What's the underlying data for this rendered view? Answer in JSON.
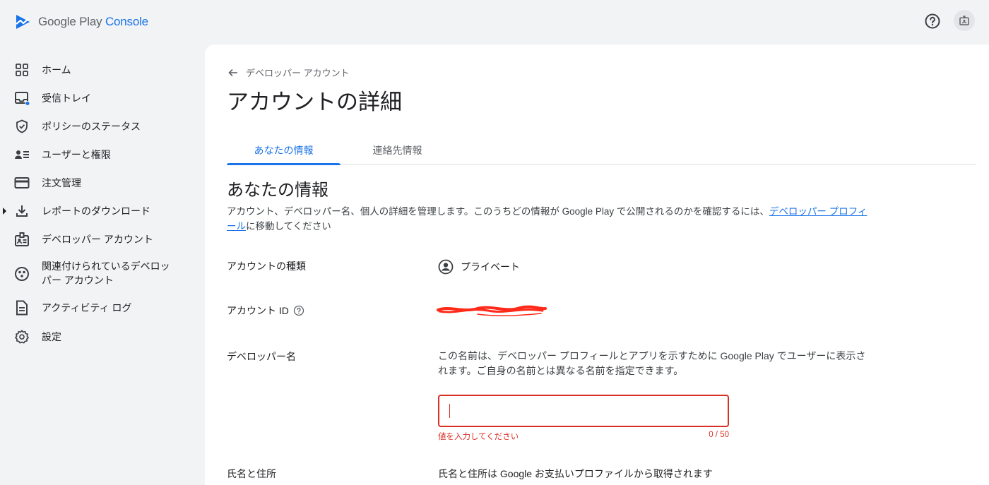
{
  "app": {
    "logo_text_primary": "Google Play",
    "logo_text_secondary": "Console"
  },
  "sidebar": {
    "items": [
      {
        "label": "ホーム",
        "icon": "dashboard-grid-icon"
      },
      {
        "label": "受信トレイ",
        "icon": "inbox-icon"
      },
      {
        "label": "ポリシーのステータス",
        "icon": "shield-icon"
      },
      {
        "label": "ユーザーと権限",
        "icon": "users-permissions-icon"
      },
      {
        "label": "注文管理",
        "icon": "credit-card-icon"
      },
      {
        "label": "レポートのダウンロード",
        "icon": "download-icon"
      },
      {
        "label": "デベロッパー アカウント",
        "icon": "badge-icon"
      },
      {
        "label": "関連付けられているデベロッパー アカウント",
        "label_line1": "関連付けられているデベロッ",
        "label_line2": "パー アカウント",
        "icon": "linked-accounts-icon"
      },
      {
        "label": "アクティビティ ログ",
        "icon": "document-icon"
      },
      {
        "label": "設定",
        "icon": "gear-icon"
      }
    ]
  },
  "main": {
    "breadcrumb": "デベロッパー アカウント",
    "page_title": "アカウントの詳細",
    "tabs": [
      {
        "label": "あなたの情報",
        "active": true
      },
      {
        "label": "連絡先情報",
        "active": false
      }
    ],
    "section_title": "あなたの情報",
    "section_desc_before": "アカウント、デベロッパー名、個人の詳細を管理します。このうちどの情報が Google Play で公開されるのかを確認するには、",
    "section_desc_link": "デベロッパー プロフィール",
    "section_desc_after": "に移動してください",
    "rows": {
      "account_type_label": "アカウントの種類",
      "account_type_value": "プライベート",
      "account_id_label": "アカウント ID",
      "developer_name_label": "デベロッパー名",
      "developer_name_desc": "この名前は、デベロッパー プロフィールとアプリを示すために Google Play でユーザーに表示されます。ご自身の名前とは異なる名前を指定できます。",
      "developer_name_value": "",
      "developer_name_error": "値を入力してください",
      "developer_name_count": "0 / 50",
      "name_address_label": "氏名と住所",
      "name_address_value": "氏名と住所は Google お支払いプロファイルから取得されます"
    }
  },
  "colors": {
    "accent": "#1a73e8",
    "error": "#d93025",
    "background": "#f1f3f4"
  }
}
